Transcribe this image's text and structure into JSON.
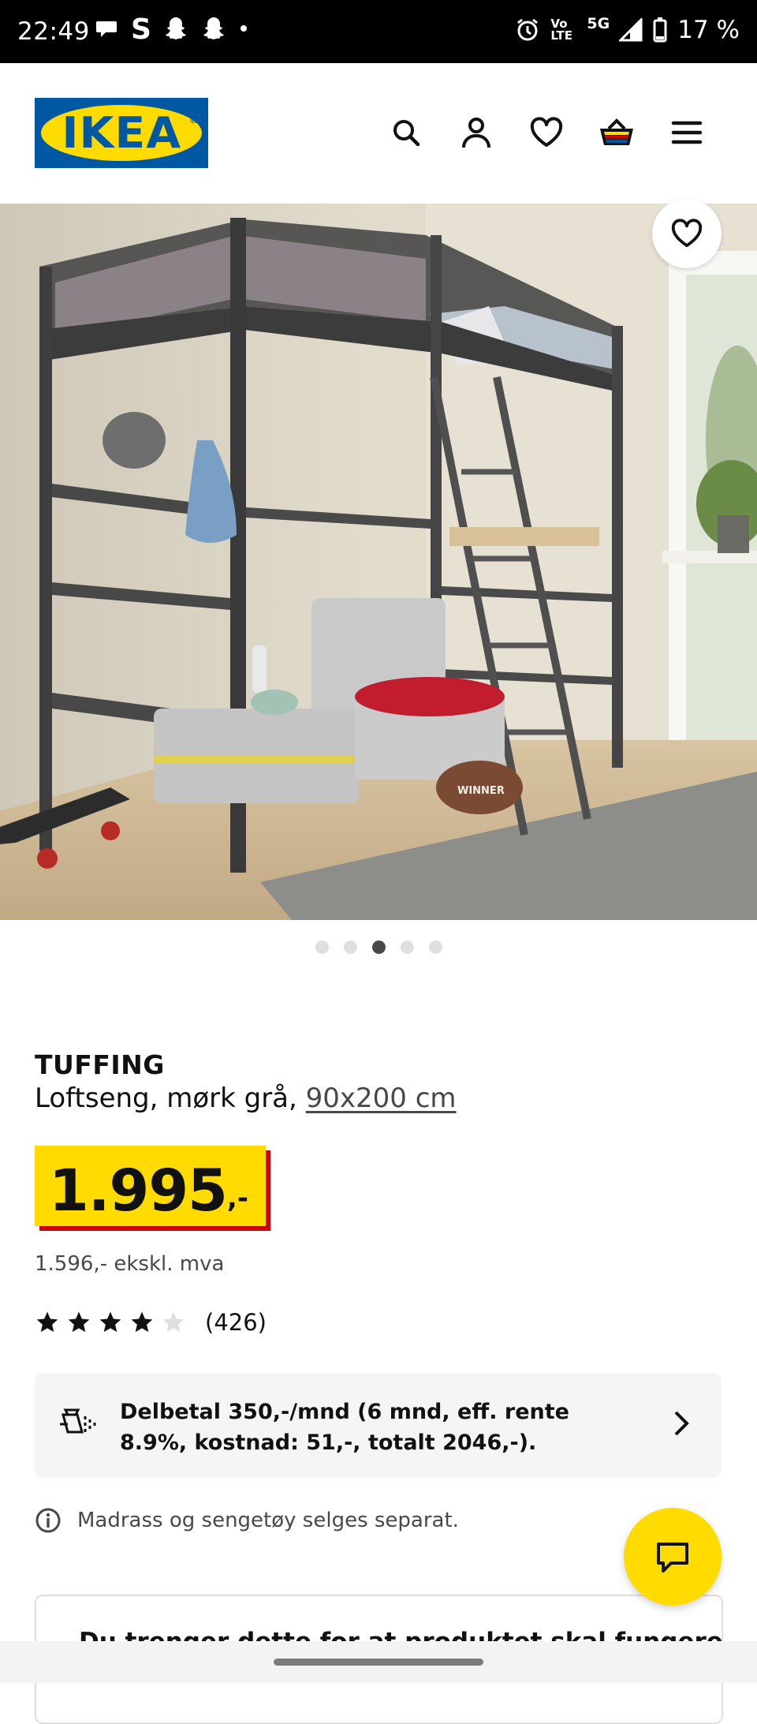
{
  "status_bar": {
    "time": "22:49",
    "left_icons": [
      "chat-bubble-icon",
      "s-app-icon",
      "snapchat-icon",
      "snapchat-icon",
      "dot-icon"
    ],
    "volte_label": "Vo LTE",
    "network": "5G",
    "battery": "17 %"
  },
  "header": {
    "logo_text": "IKEA",
    "icons": [
      "search-icon",
      "account-icon",
      "heart-icon",
      "basket-icon",
      "menu-icon"
    ]
  },
  "gallery": {
    "image_count": 5,
    "active_index": 2,
    "image_lettering": "WINNER"
  },
  "product": {
    "name": "TUFFING",
    "description_prefix": "Loftseng, mørk grå, ",
    "size_link": "90x200 cm",
    "price_integer": "1.995",
    "price_suffix": ",-",
    "price_ex_vat": "1.596,- ekskl. mva",
    "rating": 4,
    "rating_max": 5,
    "review_count": "(426)"
  },
  "installment": {
    "text": "Delbetal 350,-/mnd (6 mnd, eff. rente 8.9%, kostnad: 51,-, totalt 2046,-)."
  },
  "note": {
    "text": "Madrass og sengetøy selges separat."
  },
  "required_section": {
    "title": "Du trenger dette for at produktet skal fungere:"
  },
  "colors": {
    "ikea_blue": "#0058a3",
    "ikea_yellow": "#ffdb00",
    "price_shadow_red": "#cc0008"
  }
}
